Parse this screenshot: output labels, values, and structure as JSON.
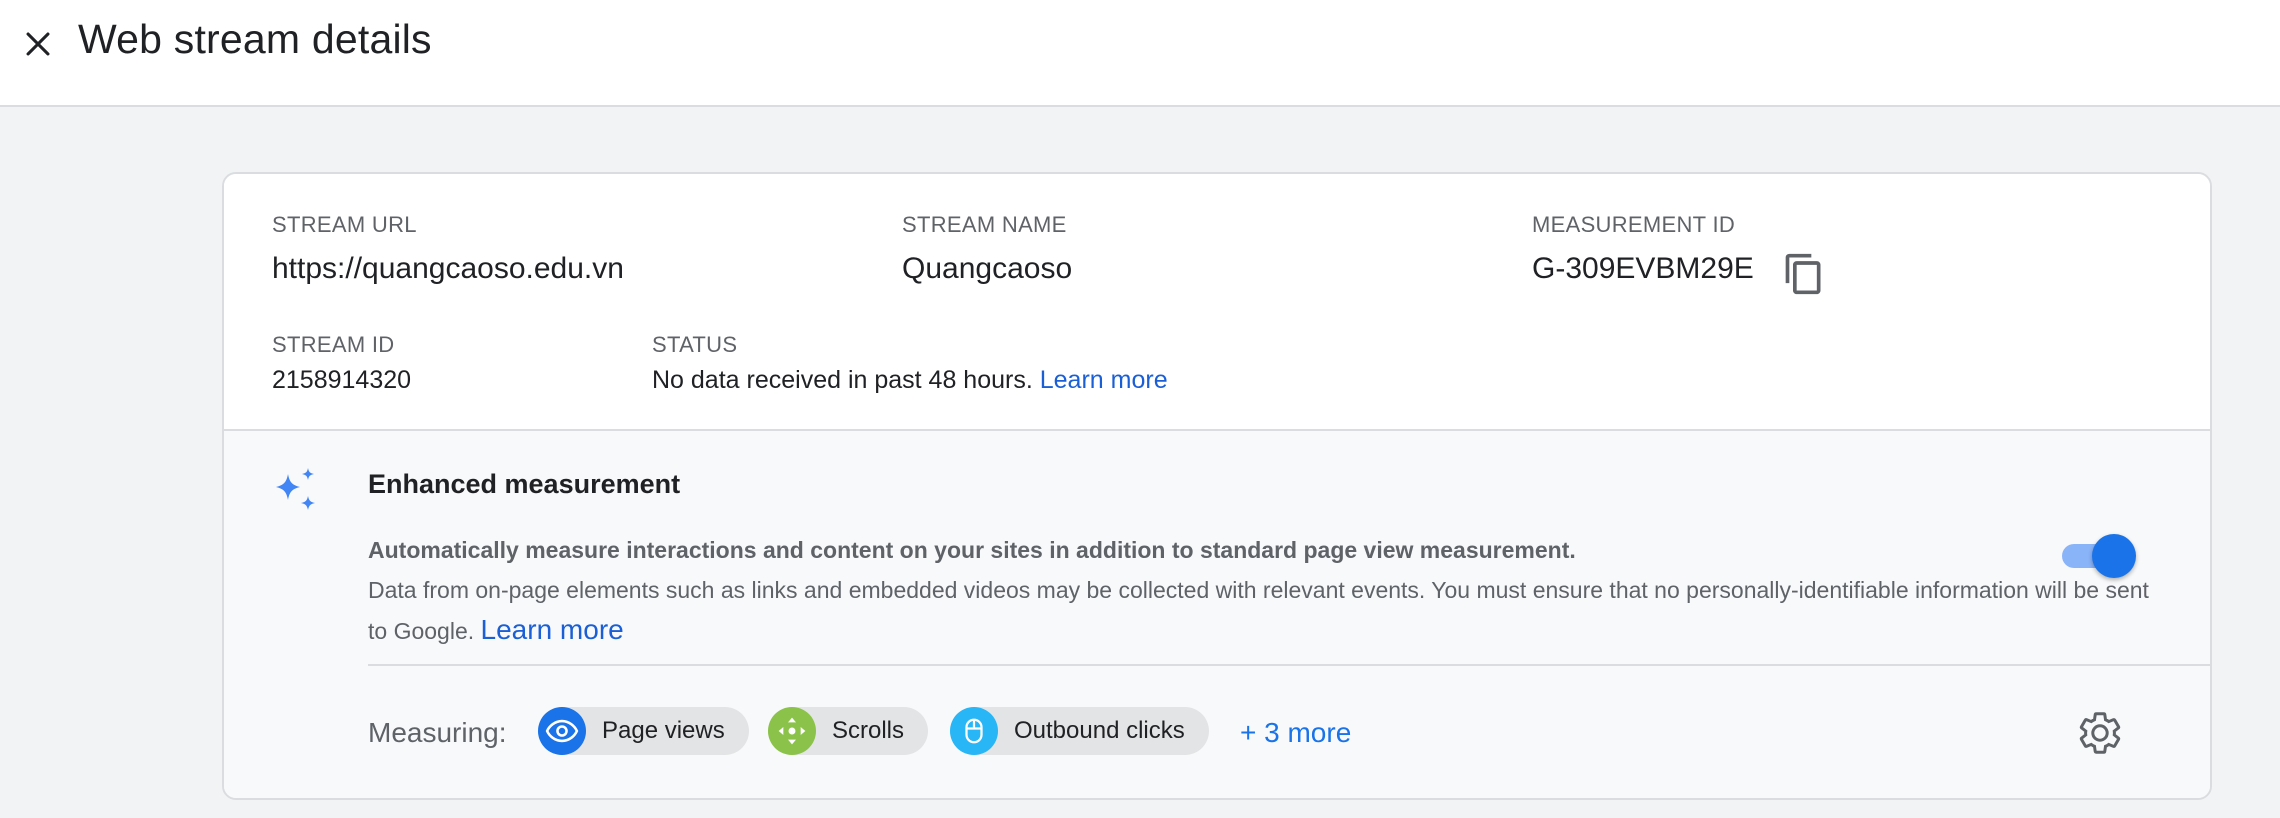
{
  "header": {
    "title": "Web stream details",
    "close_icon": "close-icon"
  },
  "stream": {
    "url_label": "STREAM URL",
    "url_value": "https://quangcaoso.edu.vn",
    "name_label": "STREAM NAME",
    "name_value": "Quangcaoso",
    "measurement_id_label": "MEASUREMENT ID",
    "measurement_id_value": "G-309EVBM29E",
    "id_label": "STREAM ID",
    "id_value": "2158914320",
    "status_label": "STATUS",
    "status_text": "No data received in past 48 hours.",
    "status_link": "Learn more"
  },
  "enhanced": {
    "title": "Enhanced measurement",
    "description_bold": "Automatically measure interactions and content on your sites in addition to standard page view measurement.",
    "description": "Data from on-page elements such as links and embedded videos may be collected with relevant events. You must ensure that no personally-identifiable information will be sent to Google.",
    "learn_more": "Learn more",
    "toggle_on": true,
    "measuring_label": "Measuring:",
    "chips": [
      {
        "label": "Page views",
        "icon": "eye-icon",
        "color": "#1a73e8"
      },
      {
        "label": "Scrolls",
        "icon": "scroll-icon",
        "color": "#8bc34a"
      },
      {
        "label": "Outbound clicks",
        "icon": "mouse-icon",
        "color": "#29b6f6"
      }
    ],
    "more_link": "+ 3 more"
  },
  "colors": {
    "accent": "#1a73e8",
    "link": "#1a5fd6",
    "sparkle": "#4285f4"
  }
}
